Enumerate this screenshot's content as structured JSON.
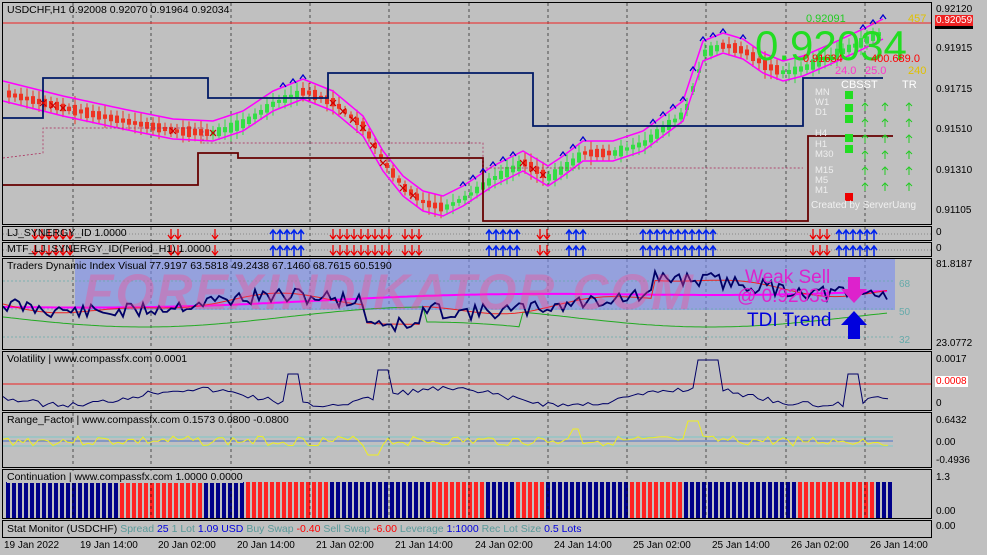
{
  "chart_data": {
    "type": "candlestick",
    "header": {
      "symbol": "USDCHF,H1",
      "open": "0.92008",
      "high": "0.92070",
      "low": "0.91964",
      "close": "0.92034"
    },
    "big_price": "0.92034",
    "main_axis": [
      "0.92120",
      "0.92034",
      "0.91915",
      "0.91715",
      "0.91510",
      "0.91310",
      "0.91105"
    ],
    "red_price": "0.92059",
    "overlay": {
      "green_top": "0.92091",
      "green_num": "457",
      "red_a": "0.91634",
      "red_b": "400.689.0",
      "pink_a": "24.0",
      "pink_b": "25.0",
      "pink_c": "240",
      "cbsst": "CBSST",
      "tr": "TR",
      "created": "Created by ServerUang",
      "rows": [
        "MN",
        "W1",
        "D1",
        "H4",
        "H1",
        "M30",
        "M15",
        "M5",
        "M1"
      ]
    },
    "sub1": {
      "label": "LJ_SYNERGY_ID 1.0000",
      "axis": "0"
    },
    "sub2": {
      "label": "MTF_LJ_SYNERGY_ID(Period_H1) 1.0000",
      "axis": "0"
    },
    "tdi": {
      "label": "Traders Dynamic Index Visual 77.9197 63.5818 49.2438 67.1460 68.7615 60.5190",
      "axis_top": "81.8187",
      "axis_bottom": "23.0772",
      "levels": [
        "68",
        "50",
        "32"
      ],
      "signal": "Weak Sell",
      "signal_price": "@ 0.92039",
      "trend": "TDI Trend",
      "watermark": "FOREXINDIKATOR.COM"
    },
    "volatility": {
      "label": "Volatility | www.compassfx.com   0.0001",
      "axis": [
        "0.0017",
        "0.0008",
        "0"
      ]
    },
    "range": {
      "label": "Range_Factor | www.compassfx.com   0.1573  0.0800  -0.0800",
      "axis": [
        "0.6432",
        "0.00",
        "-0.4936"
      ]
    },
    "continuation": {
      "label": "Continuation | www.compassfx.com   1.0000  0.0000",
      "axis": [
        "1.3",
        "0.00"
      ]
    },
    "stat": {
      "label": "Stat Monitor (USDCHF)",
      "spread_l": "Spread",
      "spread_v": "25",
      "lot_l": "1 Lot",
      "lot_v": "1.09 USD",
      "bs_l": "Buy Swap",
      "bs_v": "-0.40",
      "ss_l": "Sell Swap",
      "ss_v": "-6.00",
      "lev_l": "Leverage",
      "lev_v": "1:1000",
      "rls_l": "Rec Lot Size",
      "rls_v": "0.5 Lots",
      "axis": "0.00"
    },
    "x_labels": [
      "19 Jan 2022",
      "19 Jan 14:00",
      "20 Jan 02:00",
      "20 Jan 14:00",
      "21 Jan 02:00",
      "21 Jan 14:00",
      "24 Jan 02:00",
      "24 Jan 14:00",
      "25 Jan 02:00",
      "25 Jan 14:00",
      "26 Jan 02:00",
      "26 Jan 14:00"
    ]
  }
}
